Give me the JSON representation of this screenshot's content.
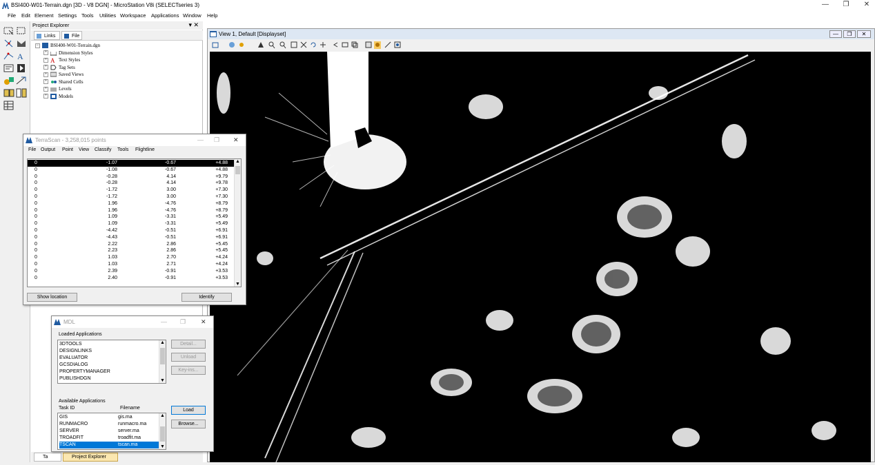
{
  "app": {
    "title": "BSI400-W01-Terrain.dgn [3D - V8 DGN] - MicroStation V8i (SELECTseries 3)",
    "window_controls": [
      "—",
      "❐",
      "✕"
    ]
  },
  "menubar": {
    "items": [
      "File",
      "Edit",
      "Element",
      "Settings",
      "Tools",
      "Utilities",
      "Workspace",
      "Applications",
      "Window",
      "Help"
    ]
  },
  "project_explorer": {
    "title": "Project Explorer",
    "header_controls": "▾ ✕",
    "tabs": [
      "Links",
      "File"
    ],
    "root": "BSI400-W01-Terrain.dgn",
    "tree": [
      "Dimension Styles",
      "Text Styles",
      "Tag Sets",
      "Saved Views",
      "Shared Cells",
      "Levels",
      "Models"
    ],
    "bottom_tabs": [
      "Ta",
      "Project Explorer"
    ]
  },
  "view": {
    "title": "View 1, Default [Displayset]",
    "controls": [
      "—",
      "❐",
      "✕"
    ]
  },
  "terrascan": {
    "title": "TerraScan - 3,258,015 points",
    "menu": [
      "File",
      "Output",
      "Point",
      "View",
      "Classify",
      "Tools",
      "Flightline"
    ],
    "rows": [
      [
        "0",
        "-1.07",
        "-0.67",
        "+4.88"
      ],
      [
        "0",
        "-1.08",
        "-0.67",
        "+4.88"
      ],
      [
        "0",
        "-0.28",
        "4.14",
        "+9.79"
      ],
      [
        "0",
        "-0.28",
        "4.14",
        "+9.78"
      ],
      [
        "0",
        "-1.72",
        "3.00",
        "+7.30"
      ],
      [
        "0",
        "-1.72",
        "3.00",
        "+7.30"
      ],
      [
        "0",
        "1.96",
        "-4.76",
        "+8.79"
      ],
      [
        "0",
        "1.96",
        "-4.76",
        "+8.79"
      ],
      [
        "0",
        "1.09",
        "-3.31",
        "+5.49"
      ],
      [
        "0",
        "1.09",
        "-3.31",
        "+5.49"
      ],
      [
        "0",
        "-4.42",
        "-0.51",
        "+6.91"
      ],
      [
        "0",
        "-4.43",
        "-0.51",
        "+6.91"
      ],
      [
        "0",
        "2.22",
        "2.86",
        "+5.45"
      ],
      [
        "0",
        "2.23",
        "2.86",
        "+5.45"
      ],
      [
        "0",
        "1.03",
        "2.70",
        "+4.24"
      ],
      [
        "0",
        "1.03",
        "2.71",
        "+4.24"
      ],
      [
        "0",
        "2.39",
        "-0.91",
        "+3.53"
      ],
      [
        "0",
        "2.40",
        "-0.91",
        "+3.53"
      ]
    ],
    "show_location": "Show location",
    "identify": "Identify"
  },
  "mdl": {
    "title": "MDL",
    "loaded_label": "Loaded Applications",
    "loaded": [
      "3DTOOLS",
      "DESIGNLINKS",
      "EVALUATOR",
      "GCSDIALOG",
      "PROPERTYMANAGER",
      "PUBLISHDGN"
    ],
    "detail": "Detail...",
    "unload": "Unload",
    "keyins": "Key-ins...",
    "available_label": "Available Applications",
    "col_task": "Task ID",
    "col_file": "Filename",
    "available": [
      [
        "GIS",
        "gis.ma"
      ],
      [
        "RUNMACRO",
        "runmacro.ma"
      ],
      [
        "SERVER",
        "server.ma"
      ],
      [
        "TROADFIT",
        "troadfit.ma"
      ],
      [
        "TSCAN",
        "tscan.ma"
      ]
    ],
    "load": "Load",
    "browse": "Browse..."
  },
  "colors": {
    "selection": "#0078d7",
    "canvas": "#000000",
    "points": "#ffffff"
  }
}
